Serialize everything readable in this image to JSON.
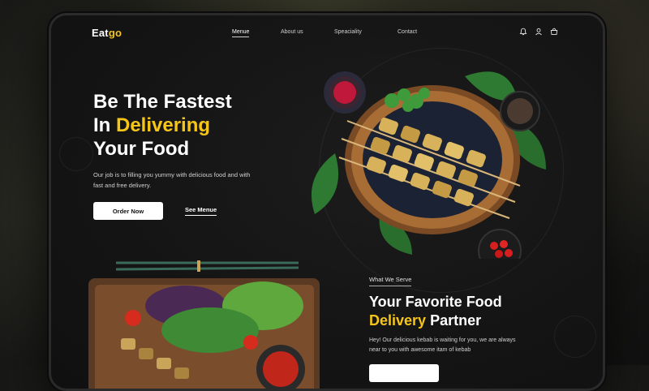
{
  "brand": {
    "name_prefix": "Eat",
    "name_suffix": "go"
  },
  "nav": {
    "links": [
      "Menue",
      "About us",
      "Speaciality",
      "Contact"
    ],
    "icons": [
      "bell-icon",
      "user-icon",
      "cart-icon"
    ]
  },
  "hero": {
    "title_line1": "Be The Fastest",
    "title_line2_prefix": "In ",
    "title_line2_accent": "Delivering",
    "title_line3": "Your Food",
    "description": "Our job is to filling you yummy with delicious food and with fast and free delivery.",
    "primary_cta": "Order Now",
    "secondary_cta": "See Menue"
  },
  "serve": {
    "label": "What We Serve",
    "title_line1": "Your Favorite Food",
    "title_line2_accent": "Delivery",
    "title_line2_rest": " Partner",
    "description": "Hey! Our delicious kebab is waiting for you, we are always near to you with awesome itam of kebab"
  },
  "colors": {
    "accent": "#f5c518",
    "background": "#141414",
    "text": "#ffffff"
  }
}
